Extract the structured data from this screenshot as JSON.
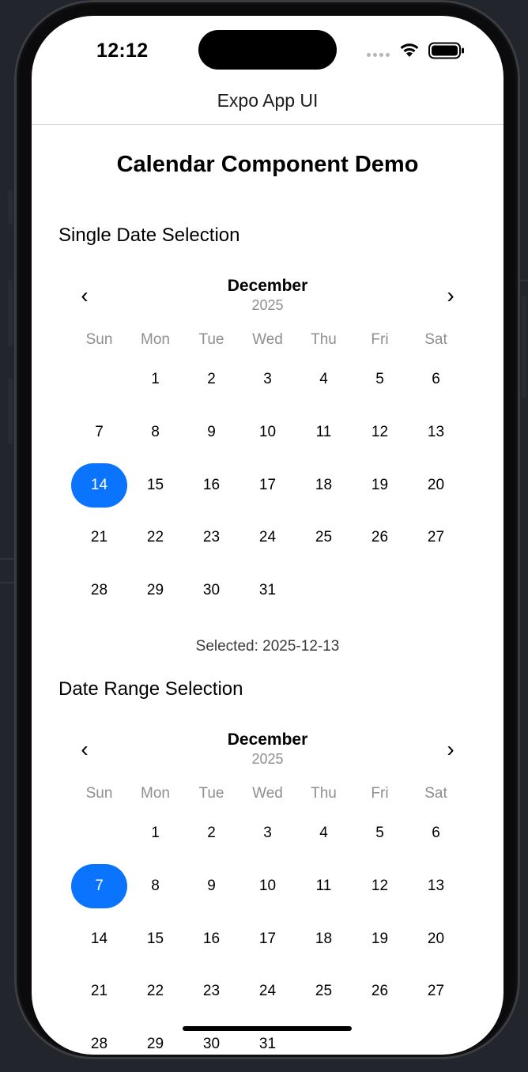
{
  "status_bar": {
    "time": "12:12"
  },
  "header": {
    "title": "Expo App UI"
  },
  "page": {
    "title": "Calendar Component Demo"
  },
  "single": {
    "section_title": "Single Date Selection",
    "calendar": {
      "month": "December",
      "year": "2025",
      "prev_label": "‹",
      "next_label": "›",
      "weekdays": [
        "Sun",
        "Mon",
        "Tue",
        "Wed",
        "Thu",
        "Fri",
        "Sat"
      ],
      "leading_blanks": 1,
      "days": [
        "1",
        "2",
        "3",
        "4",
        "5",
        "6",
        "7",
        "8",
        "9",
        "10",
        "11",
        "12",
        "13",
        "14",
        "15",
        "16",
        "17",
        "18",
        "19",
        "20",
        "21",
        "22",
        "23",
        "24",
        "25",
        "26",
        "27",
        "28",
        "29",
        "30",
        "31"
      ],
      "selected_day": "14"
    },
    "selected_text": "Selected: 2025-12-13"
  },
  "range": {
    "section_title": "Date Range Selection",
    "calendar": {
      "month": "December",
      "year": "2025",
      "prev_label": "‹",
      "next_label": "›",
      "weekdays": [
        "Sun",
        "Mon",
        "Tue",
        "Wed",
        "Thu",
        "Fri",
        "Sat"
      ],
      "leading_blanks": 1,
      "days": [
        "1",
        "2",
        "3",
        "4",
        "5",
        "6",
        "7",
        "8",
        "9",
        "10",
        "11",
        "12",
        "13",
        "14",
        "15",
        "16",
        "17",
        "18",
        "19",
        "20",
        "21",
        "22",
        "23",
        "24",
        "25",
        "26",
        "27",
        "28",
        "29",
        "30",
        "31"
      ],
      "selected_day": "7"
    }
  },
  "colors": {
    "accent": "#0a74ff",
    "muted_text": "#8e8e93",
    "background_outer": "#23252c"
  },
  "icons": [
    "wifi-icon",
    "battery-icon",
    "cellular-signal-icon",
    "chevron-left-icon",
    "chevron-right-icon"
  ]
}
